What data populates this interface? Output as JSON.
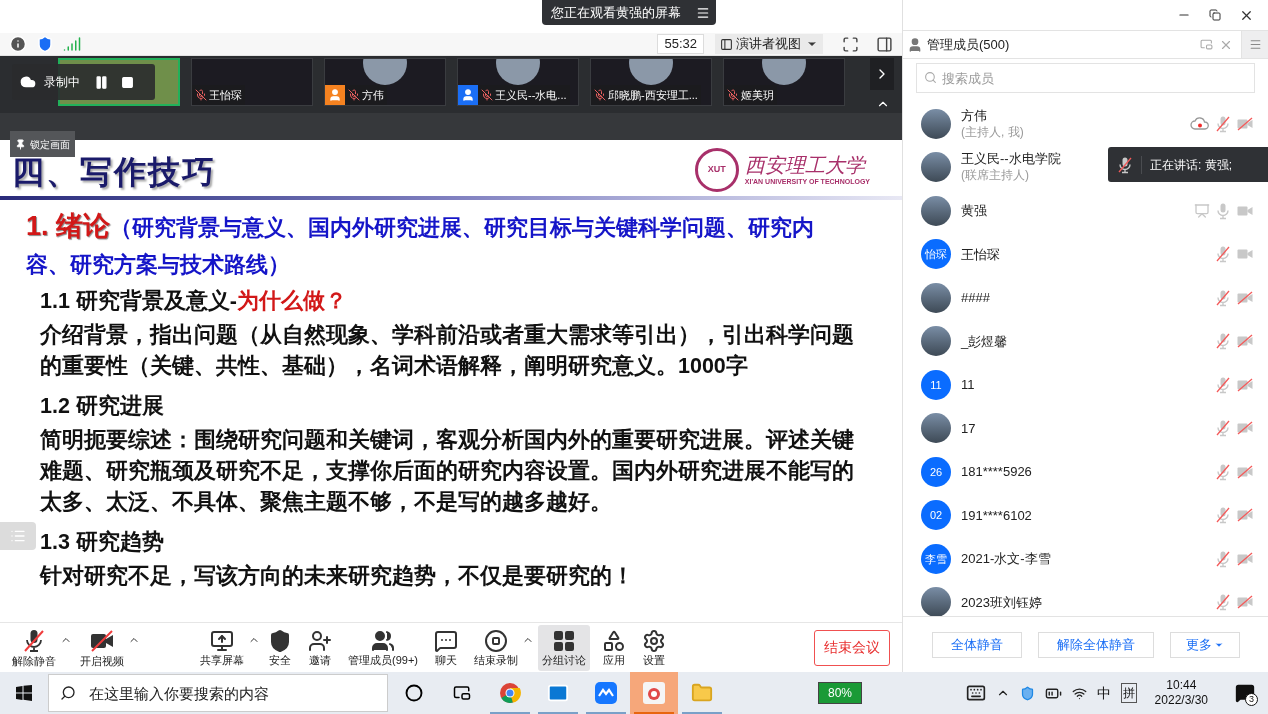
{
  "notice": {
    "text": "您正在观看黄强的屏幕"
  },
  "toolbar": {
    "timer": "55:32",
    "view_mode": "演讲者视图"
  },
  "recording": {
    "label": "录制中"
  },
  "video_tiles": [
    {
      "kind": "landscape",
      "selected": true
    },
    {
      "kind": "blank",
      "name": "王怡琛",
      "selected": false,
      "mic_muted": true
    },
    {
      "kind": "avatar",
      "name": "方伟",
      "selected": false,
      "mic_muted": true,
      "color": "#f58220"
    },
    {
      "kind": "avatar",
      "name": "王义民--水电...",
      "selected": false,
      "mic_muted": true,
      "color": "#1a6ef5"
    },
    {
      "kind": "avatar",
      "name": "邱晓鹏-西安理工...",
      "selected": false,
      "mic_muted": true
    },
    {
      "kind": "avatar",
      "name": "姬美玥",
      "selected": false,
      "mic_muted": true
    }
  ],
  "lock_button": "锁定画面",
  "slide": {
    "title": "四、写作技巧",
    "logo": {
      "name": "西安理工大学",
      "english": "XI'AN UNIVERSITY OF TECHNOLOGY",
      "seal": "XUT"
    },
    "heading": {
      "label": "1. 绪论",
      "detail": "（研究背景与意义、国内外研究进展、研究目标与关键科学问题、研究内容、研究方案与技术路线）"
    },
    "sections": [
      {
        "title": "1.1 研究背景及意义-",
        "emphasis": "为什么做？",
        "body": "介绍背景，指出问题（从自然现象、学科前沿或者重大需求等引出），引出科学问题的重要性（关键、共性、基础），名词术语解释，阐明研究意义。1000字"
      },
      {
        "title": "1.2 研究进展",
        "body": "简明扼要综述：围绕研究问题和关键词，客观分析国内外的重要研究进展。评述关键难题、研究瓶颈及研究不足，支撑你后面的研究内容设置。国内外研究进展不能写的太多、太泛、不具体、聚焦主题不够，不是写的越多越好。"
      },
      {
        "title": "1.3 研究趋势",
        "body": "针对研究不足，写该方向的未来研究趋势，不仅是要研究的！"
      }
    ]
  },
  "bottom_toolbar": {
    "items": [
      {
        "kind": "mic_off",
        "label": "解除静音",
        "caret": true,
        "selected": false
      },
      {
        "kind": "video_off",
        "label": "开启视频",
        "caret": true,
        "selected": false
      },
      {
        "kind": "share",
        "label": "共享屏幕",
        "caret": true,
        "selected": false
      },
      {
        "kind": "security",
        "label": "安全",
        "caret": false,
        "selected": false
      },
      {
        "kind": "invite",
        "label": "邀请",
        "caret": false,
        "selected": false
      },
      {
        "kind": "members",
        "label": "管理成员(99+)",
        "caret": false,
        "selected": false
      },
      {
        "kind": "chat",
        "label": "聊天",
        "caret": false,
        "selected": false
      },
      {
        "kind": "stop_record",
        "label": "结束录制",
        "caret": true,
        "selected": false
      },
      {
        "kind": "breakout",
        "label": "分组讨论",
        "caret": false,
        "selected": true
      },
      {
        "kind": "apps",
        "label": "应用",
        "caret": false,
        "selected": false
      },
      {
        "kind": "settings",
        "label": "设置",
        "caret": false,
        "selected": false
      }
    ],
    "end_button": "结束会议"
  },
  "panel": {
    "title": "管理成员(500)",
    "search_placeholder": "搜索成员",
    "members": [
      {
        "name": "方伟",
        "role": "(主持人, 我)",
        "avatar": {
          "kind": "photo"
        },
        "recording": true,
        "mic_muted": true,
        "camera_off": true
      },
      {
        "name": "王义民--水电学院",
        "role": "(联席主持人)",
        "avatar": {
          "kind": "photo"
        }
      },
      {
        "name": "黄强",
        "avatar": {
          "kind": "photo"
        },
        "sharing": true,
        "mic_muted": false,
        "camera_off": false
      },
      {
        "name": "王怡琛",
        "avatar": {
          "kind": "initials",
          "text": "怡琛"
        },
        "mic_muted": true,
        "camera_off": false
      },
      {
        "name": "####",
        "avatar": {
          "kind": "photo"
        },
        "mic_muted": true,
        "camera_off": true
      },
      {
        "name": "_彭煜馨",
        "avatar": {
          "kind": "photo"
        },
        "mic_muted": true,
        "camera_off": true
      },
      {
        "name": "11",
        "avatar": {
          "kind": "initials",
          "text": "11"
        },
        "mic_muted": true,
        "camera_off": true
      },
      {
        "name": "17",
        "avatar": {
          "kind": "photo"
        },
        "mic_muted": true,
        "camera_off": true
      },
      {
        "name": "181****5926",
        "avatar": {
          "kind": "initials",
          "text": "26"
        },
        "mic_muted": true,
        "camera_off": true
      },
      {
        "name": "191****6102",
        "avatar": {
          "kind": "initials",
          "text": "02"
        },
        "mic_muted": true,
        "camera_off": true
      },
      {
        "name": "2021-水文-李雪",
        "avatar": {
          "kind": "initials",
          "text": "李雪"
        },
        "mic_muted": true,
        "camera_off": true
      },
      {
        "name": "2023班刘钰婷",
        "avatar": {
          "kind": "photo"
        },
        "mic_muted": true,
        "camera_off": true
      }
    ],
    "buttons": [
      "全体静音",
      "解除全体静音"
    ],
    "more": "更多"
  },
  "speaking_tooltip": "正在讲话: 黄强;",
  "taskbar": {
    "search_placeholder": "在这里输入你要搜索的内容",
    "apps": [
      {
        "kind": "cortana",
        "running": false,
        "selected": false
      },
      {
        "kind": "taskview",
        "running": false,
        "selected": false
      },
      {
        "kind": "chrome",
        "running": true,
        "selected": false
      },
      {
        "kind": "mail",
        "running": true,
        "selected": false
      },
      {
        "kind": "meeting",
        "running": true,
        "selected": false
      },
      {
        "kind": "game",
        "running": true,
        "selected": true
      },
      {
        "kind": "explorer",
        "running": true,
        "selected": false
      }
    ],
    "battery": "80%",
    "ime_lang": "中",
    "ime_mode": "拼",
    "time": "10:44",
    "date": "2022/3/30",
    "notifications": "3"
  }
}
